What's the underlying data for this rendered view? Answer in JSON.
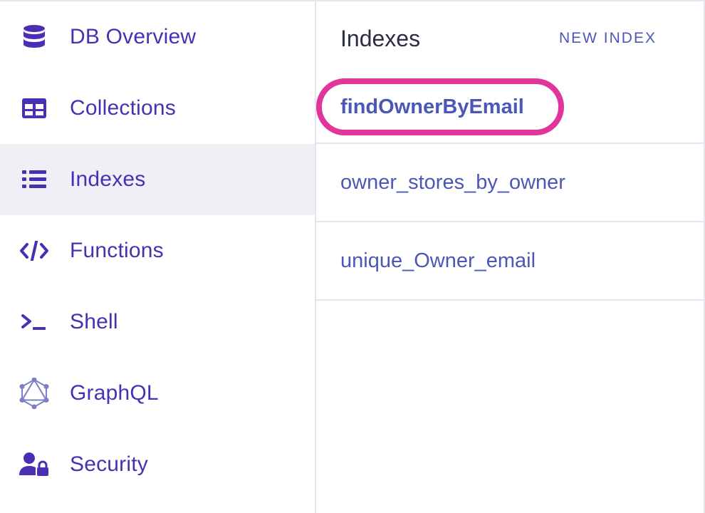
{
  "sidebar": {
    "items": [
      {
        "label": "DB Overview",
        "icon": "database-icon"
      },
      {
        "label": "Collections",
        "icon": "table-icon"
      },
      {
        "label": "Indexes",
        "icon": "list-icon",
        "active": true
      },
      {
        "label": "Functions",
        "icon": "code-icon"
      },
      {
        "label": "Shell",
        "icon": "terminal-icon"
      },
      {
        "label": "GraphQL",
        "icon": "graphql-icon"
      },
      {
        "label": "Security",
        "icon": "user-lock-icon"
      }
    ]
  },
  "main": {
    "title": "Indexes",
    "new_index_label": "NEW INDEX",
    "indexes": [
      {
        "name": "findOwnerByEmail",
        "highlighted": true
      },
      {
        "name": "owner_stores_by_owner"
      },
      {
        "name": "unique_Owner_email"
      }
    ]
  },
  "colors": {
    "accent": "#4a2fb5",
    "link": "#4b57b8",
    "highlight": "#e0359a",
    "active_bg": "#eff0f5",
    "border": "#e4e5ec"
  }
}
